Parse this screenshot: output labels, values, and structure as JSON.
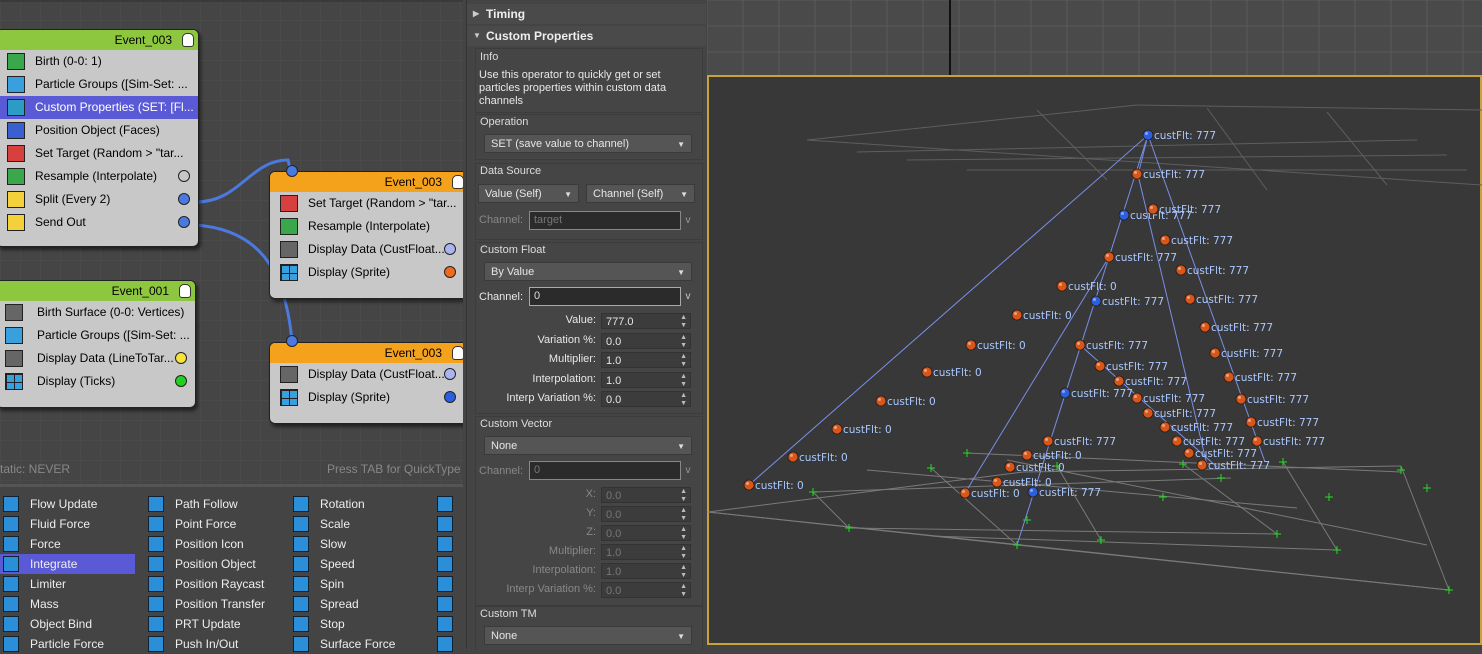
{
  "graph": {
    "events": [
      {
        "title": "Event_003",
        "ops": [
          {
            "label": "Birth (0-0: 1)",
            "icon": "birth-icon"
          },
          {
            "label": "Particle Groups ([Sim-Set: ...",
            "icon": "particle-groups-icon"
          },
          {
            "label": "Custom Properties (SET: [Fl...",
            "icon": "custom-properties-icon"
          },
          {
            "label": "Position Object (Faces)",
            "icon": "position-object-icon"
          },
          {
            "label": "Set Target (Random > \"tar...",
            "icon": "set-target-icon"
          },
          {
            "label": "Resample (Interpolate)",
            "icon": "resample-icon"
          },
          {
            "label": "Split (Every 2)",
            "icon": "split-icon"
          },
          {
            "label": "Send Out",
            "icon": "send-out-icon"
          }
        ]
      },
      {
        "title": "Event_003",
        "ops": [
          {
            "label": "Set Target (Random > \"tar...",
            "icon": "set-target-icon"
          },
          {
            "label": "Resample (Interpolate)",
            "icon": "resample-icon"
          },
          {
            "label": "Display Data (CustFloat...",
            "icon": "display-data-icon"
          },
          {
            "label": "Display (Sprite)",
            "icon": "display-icon"
          }
        ]
      },
      {
        "title": "Event_001",
        "ops": [
          {
            "label": "Birth Surface (0-0: Vertices)",
            "icon": "birth-surface-icon"
          },
          {
            "label": "Particle Groups ([Sim-Set: ...",
            "icon": "particle-groups-icon"
          },
          {
            "label": "Display Data (LineToTar...",
            "icon": "display-data-icon"
          },
          {
            "label": "Display (Ticks)",
            "icon": "display-icon"
          }
        ]
      },
      {
        "title": "Event_003",
        "ops": [
          {
            "label": "Display Data (CustFloat...",
            "icon": "display-data-icon"
          },
          {
            "label": "Display (Sprite)",
            "icon": "display-icon"
          }
        ]
      }
    ],
    "status_left": "tatic: NEVER",
    "status_right": "Press TAB for QuickType",
    "port_colors": {
      "gray": "#c8c8c8",
      "blue": "#4a7ae0",
      "lavender": "#a9b4f0",
      "orange": "#f06a1e",
      "yellow": "#f5e23a",
      "green": "#22d022"
    }
  },
  "depot": {
    "col1": [
      "Flow Update",
      "Fluid Force",
      "Force",
      "Integrate",
      "Limiter",
      "Mass",
      "Object Bind",
      "Particle Force"
    ],
    "col2": [
      "Path Follow",
      "Point Force",
      "Position Icon",
      "Position Object",
      "Position Raycast",
      "Position Transfer",
      "PRT Update",
      "Push In/Out"
    ],
    "col3": [
      "Rotation",
      "Scale",
      "Slow",
      "Speed",
      "Spin",
      "Spread",
      "Stop",
      "Surface Force"
    ],
    "selected": "Integrate",
    "selection_color": "#5a5ad6"
  },
  "panel": {
    "timing_label": "Timing",
    "custom_props_label": "Custom Properties",
    "info_title": "Info",
    "info_lines": [
      "Use this operator to quickly get or set",
      "particles properties within custom data",
      "channels"
    ],
    "operation_title": "Operation",
    "operation_value": "SET (save value to channel)",
    "data_source_title": "Data Source",
    "data_source_value": "Value (Self)",
    "data_source_channel": "Channel (Self)",
    "channel_label": "Channel:",
    "channel_target": "target",
    "v_label": "v",
    "custom_float_title": "Custom Float",
    "custom_float_mode": "By Value",
    "custom_float_channel": "0",
    "float_params": [
      {
        "label": "Value:",
        "value": "777.0"
      },
      {
        "label": "Variation %:",
        "value": "0.0"
      },
      {
        "label": "Multiplier:",
        "value": "1.0"
      },
      {
        "label": "Interpolation:",
        "value": "1.0"
      },
      {
        "label": "Interp Variation %:",
        "value": "0.0"
      }
    ],
    "custom_vector_title": "Custom Vector",
    "custom_vector_mode": "None",
    "custom_vector_channel": "0",
    "vector_params": [
      {
        "label": "X:",
        "value": "0.0"
      },
      {
        "label": "Y:",
        "value": "0.0"
      },
      {
        "label": "Z:",
        "value": "0.0"
      },
      {
        "label": "Multiplier:",
        "value": "1.0"
      },
      {
        "label": "Interpolation:",
        "value": "1.0"
      },
      {
        "label": "Interp Variation %:",
        "value": "0.0"
      }
    ],
    "custom_tm_title": "Custom TM",
    "custom_tm_mode": "None"
  },
  "viewport": {
    "label_777": "custFlt: 777",
    "label_0": "custFlt: 0",
    "colors": {
      "bg": "#383838",
      "grid_lines": "#7a7a7a",
      "wire": "#7a8ee8",
      "orange_particle": "#d8561a",
      "blue_particle": "#2a5fe0",
      "label_text": "#aac8ff",
      "tick": "#22dd22",
      "frame": "#c8a23a"
    }
  }
}
